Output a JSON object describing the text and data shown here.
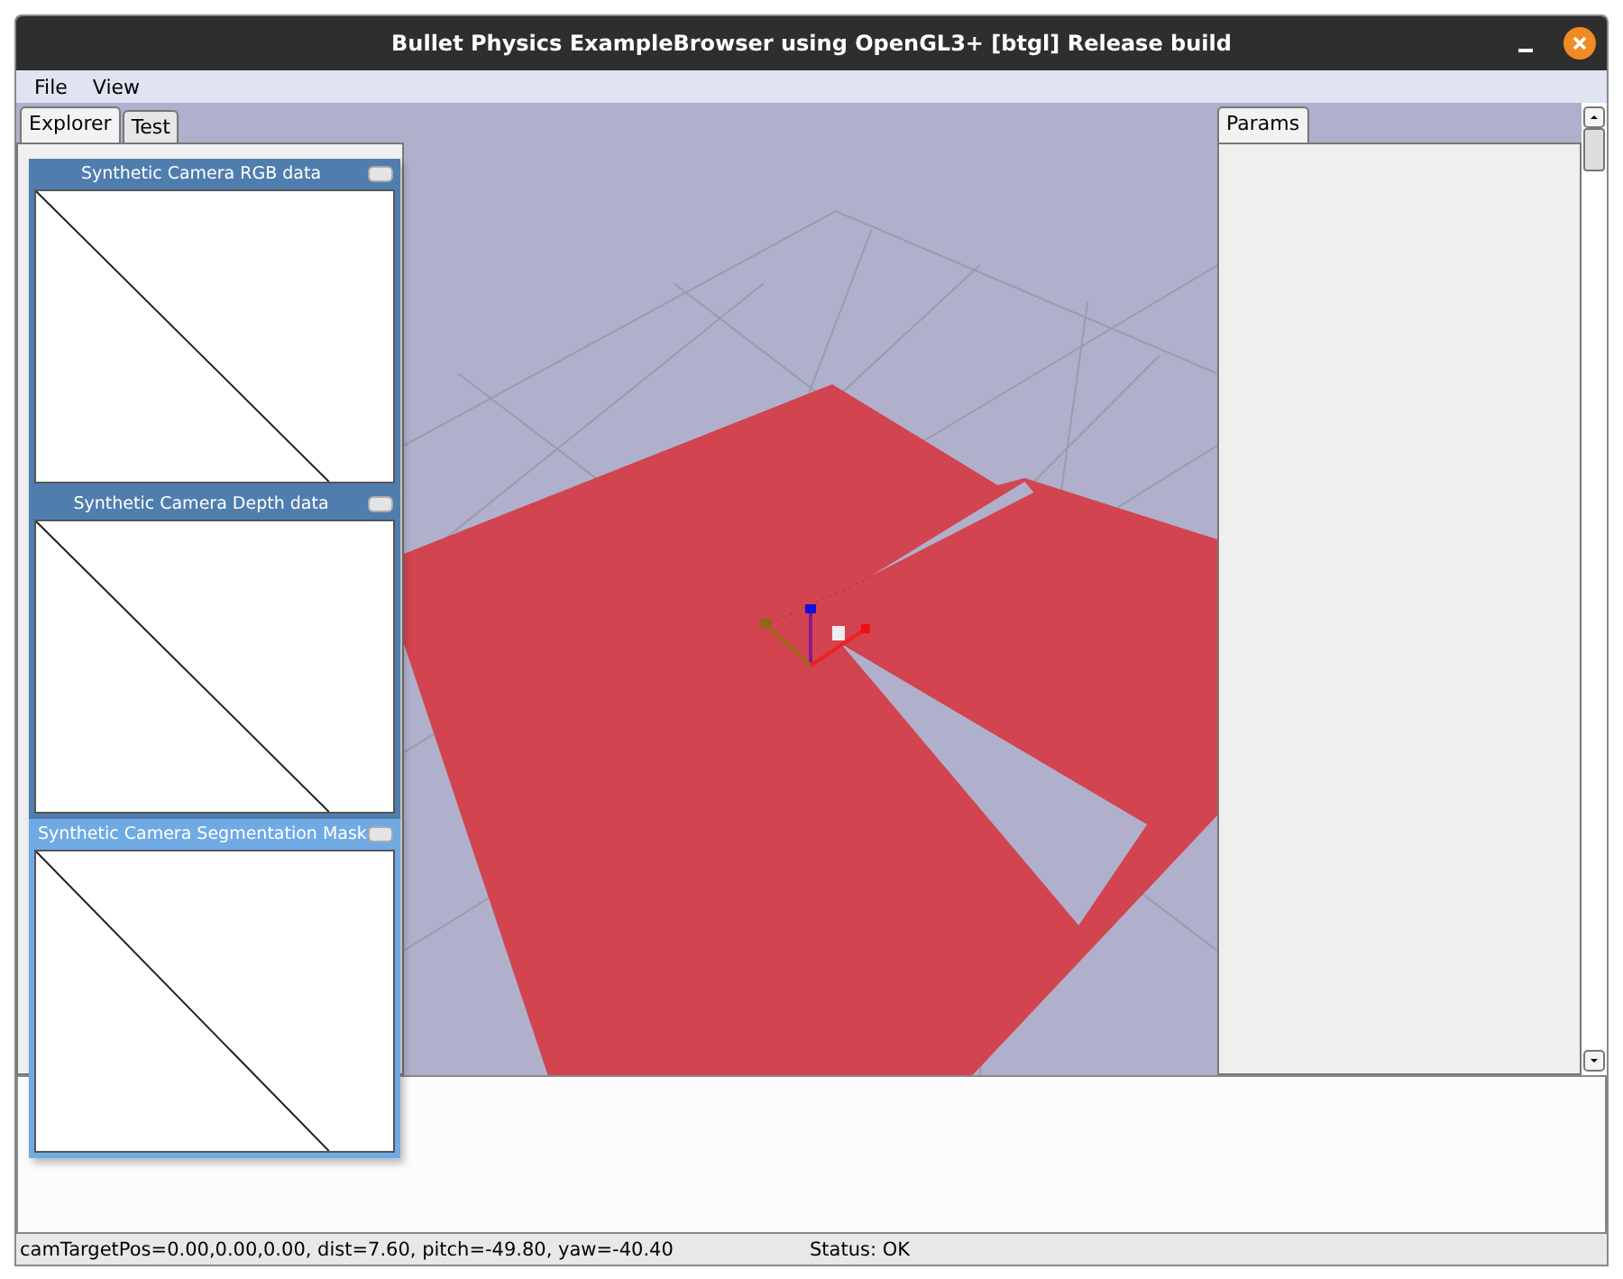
{
  "window": {
    "title": "Bullet Physics ExampleBrowser using OpenGL3+ [btgl] Release build"
  },
  "menu": [
    "File",
    "View"
  ],
  "left_tabs": [
    {
      "label": "Explorer",
      "selected": true
    },
    {
      "label": "Test",
      "selected": false
    }
  ],
  "right_tabs": [
    {
      "label": "Params",
      "selected": true
    }
  ],
  "viewport": {
    "kind": "picture"
  },
  "camera_windows": [
    {
      "title": "Synthetic Camera RGB data",
      "active": false
    },
    {
      "title": "Synthetic Camera Depth data",
      "active": false
    },
    {
      "title": "Synthetic Camera Segmentation Mask",
      "active": true
    }
  ],
  "status_bar": {
    "camera": "camTargetPos=0.00,0.00,0.00, dist=7.60, pitch=-49.80, yaw=-40.40",
    "status": "Status: OK"
  }
}
